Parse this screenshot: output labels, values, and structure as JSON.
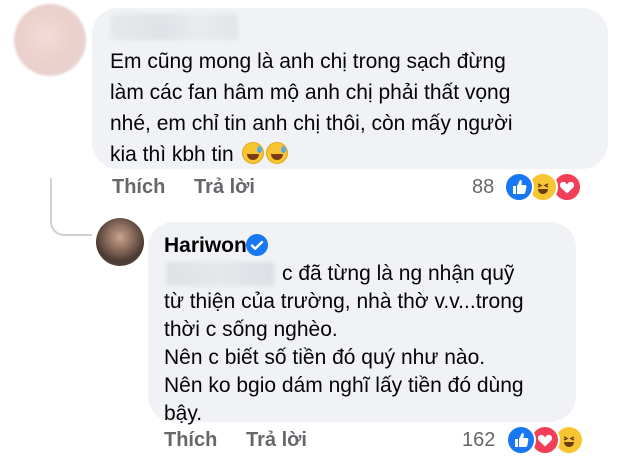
{
  "comment1": {
    "lines": [
      "Em cũng mong là anh chị trong sạch đừng",
      "làm các fan hâm mộ anh chị phải thất vọng",
      "nhé, em chỉ tin anh chị thôi, còn mấy người",
      "kia thì kbh tin"
    ],
    "like_label": "Thích",
    "reply_label": "Trả lời",
    "reaction_count": "88",
    "reactions": [
      "like",
      "haha",
      "love"
    ]
  },
  "comment2": {
    "author": "Hariwon",
    "lines": [
      "c đã từng là ng nhận quỹ",
      "từ thiện của trường, nhà thờ v.v...trong",
      "thời c sống nghèo.",
      "Nên c biết số tiền đó quý như nào.",
      "Nên ko bgio dám nghĩ lấy tiền đó dùng",
      "bậy."
    ],
    "like_label": "Thích",
    "reply_label": "Trả lời",
    "reaction_count": "162",
    "reactions": [
      "like",
      "love",
      "haha"
    ]
  },
  "colors": {
    "bubble": "#f0f2f5",
    "like": "#1877f2",
    "love": "#f33e58",
    "haha": "#f7c531",
    "meta": "#65676b"
  }
}
